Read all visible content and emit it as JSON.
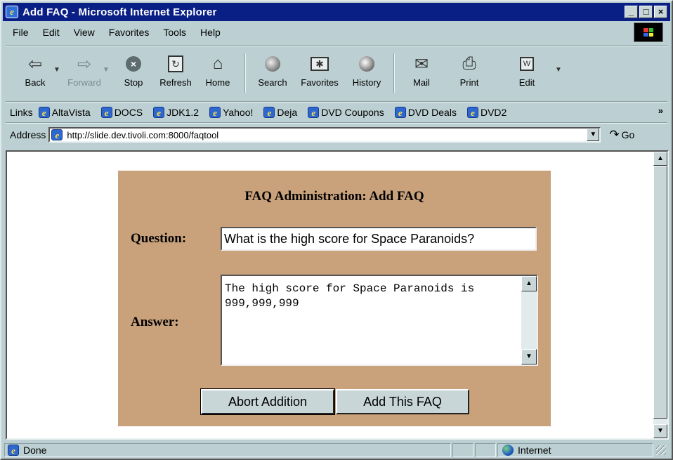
{
  "window": {
    "title": "Add FAQ - Microsoft Internet Explorer",
    "controls": {
      "minimize": "_",
      "maximize": "□",
      "close": "×"
    }
  },
  "menubar": {
    "items": [
      "File",
      "Edit",
      "View",
      "Favorites",
      "Tools",
      "Help"
    ]
  },
  "toolbar": {
    "back": "Back",
    "forward": "Forward",
    "stop": "Stop",
    "refresh": "Refresh",
    "home": "Home",
    "search": "Search",
    "favorites": "Favorites",
    "history": "History",
    "mail": "Mail",
    "print": "Print",
    "edit": "Edit"
  },
  "links": {
    "label": "Links",
    "items": [
      "AltaVista",
      "DOCS",
      "JDK1.2",
      "Yahoo!",
      "Deja",
      "DVD Coupons",
      "DVD Deals",
      "DVD2"
    ],
    "more": "»"
  },
  "address": {
    "label": "Address",
    "url": "http://slide.dev.tivoli.com:8000/faqtool",
    "go": "Go"
  },
  "form": {
    "heading": "FAQ Administration: Add FAQ",
    "question_label": "Question:",
    "question_value": "What is the high score for Space Paranoids?",
    "answer_label": "Answer:",
    "answer_value": "The high score for Space Paranoids is 999,999,999",
    "abort_button": "Abort Addition",
    "add_button": "Add This FAQ",
    "panel_color": "#c9a27c"
  },
  "status": {
    "text": "Done",
    "zone": "Internet"
  },
  "colors": {
    "title_bar": "#0a1f86",
    "chrome": "#bccfd2"
  }
}
